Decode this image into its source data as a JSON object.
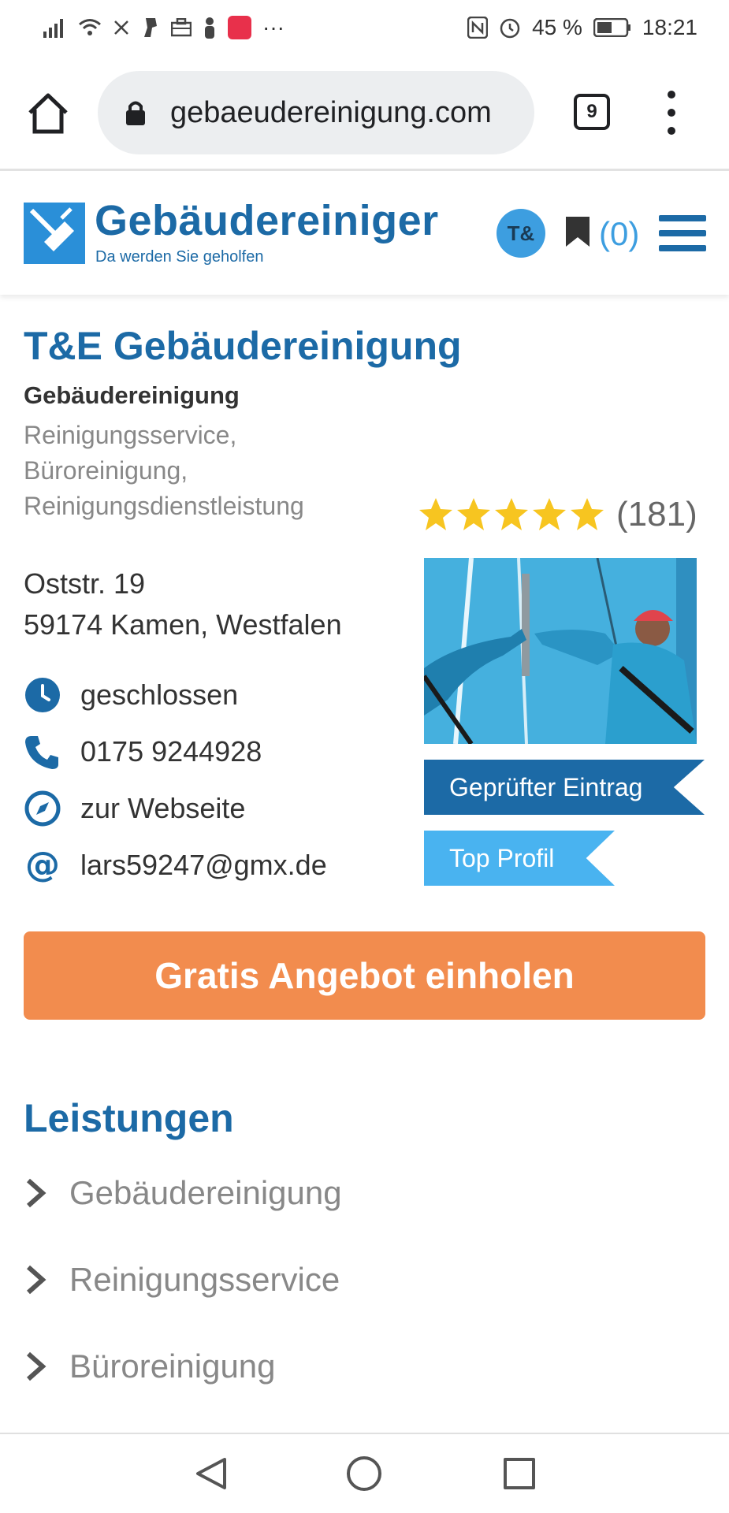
{
  "status_bar": {
    "battery": "45 %",
    "time": "18:21",
    "more": "···"
  },
  "browser": {
    "url": "gebaeudereinigung.com",
    "tab_count": "9"
  },
  "header": {
    "logo_title": "Gebäudereiniger",
    "logo_subtitle": "Da werden Sie geholfen",
    "avatar_initials": "T&",
    "bookmark_count": "(0)"
  },
  "company": {
    "name": "T&E Gebäudereinigung",
    "category": "Gebäudereinigung",
    "services_line1": "Reinigungsservice,",
    "services_line2": "Büroreinigung,",
    "services_line3": "Reinigungsdienstleistung",
    "rating_stars": 5,
    "rating_count": "(181)",
    "address_line1": "Oststr. 19",
    "address_line2": "59174 Kamen, Westfalen",
    "opening_status": "geschlossen",
    "phone": "0175 9244928",
    "website_label": "zur Webseite",
    "email": "lars59247@gmx.de",
    "badge_verified": "Geprüfter Eintrag",
    "badge_top": "Top Profil"
  },
  "cta": {
    "label": "Gratis Angebot einholen"
  },
  "services_section": {
    "title": "Leistungen",
    "items": [
      "Gebäudereinigung",
      "Reinigungsservice",
      "Büroreinigung"
    ]
  },
  "colors": {
    "brand_blue": "#1c6aa6",
    "light_blue": "#49b3f0",
    "cta_orange": "#f28c4e",
    "star_yellow": "#f7c520"
  }
}
